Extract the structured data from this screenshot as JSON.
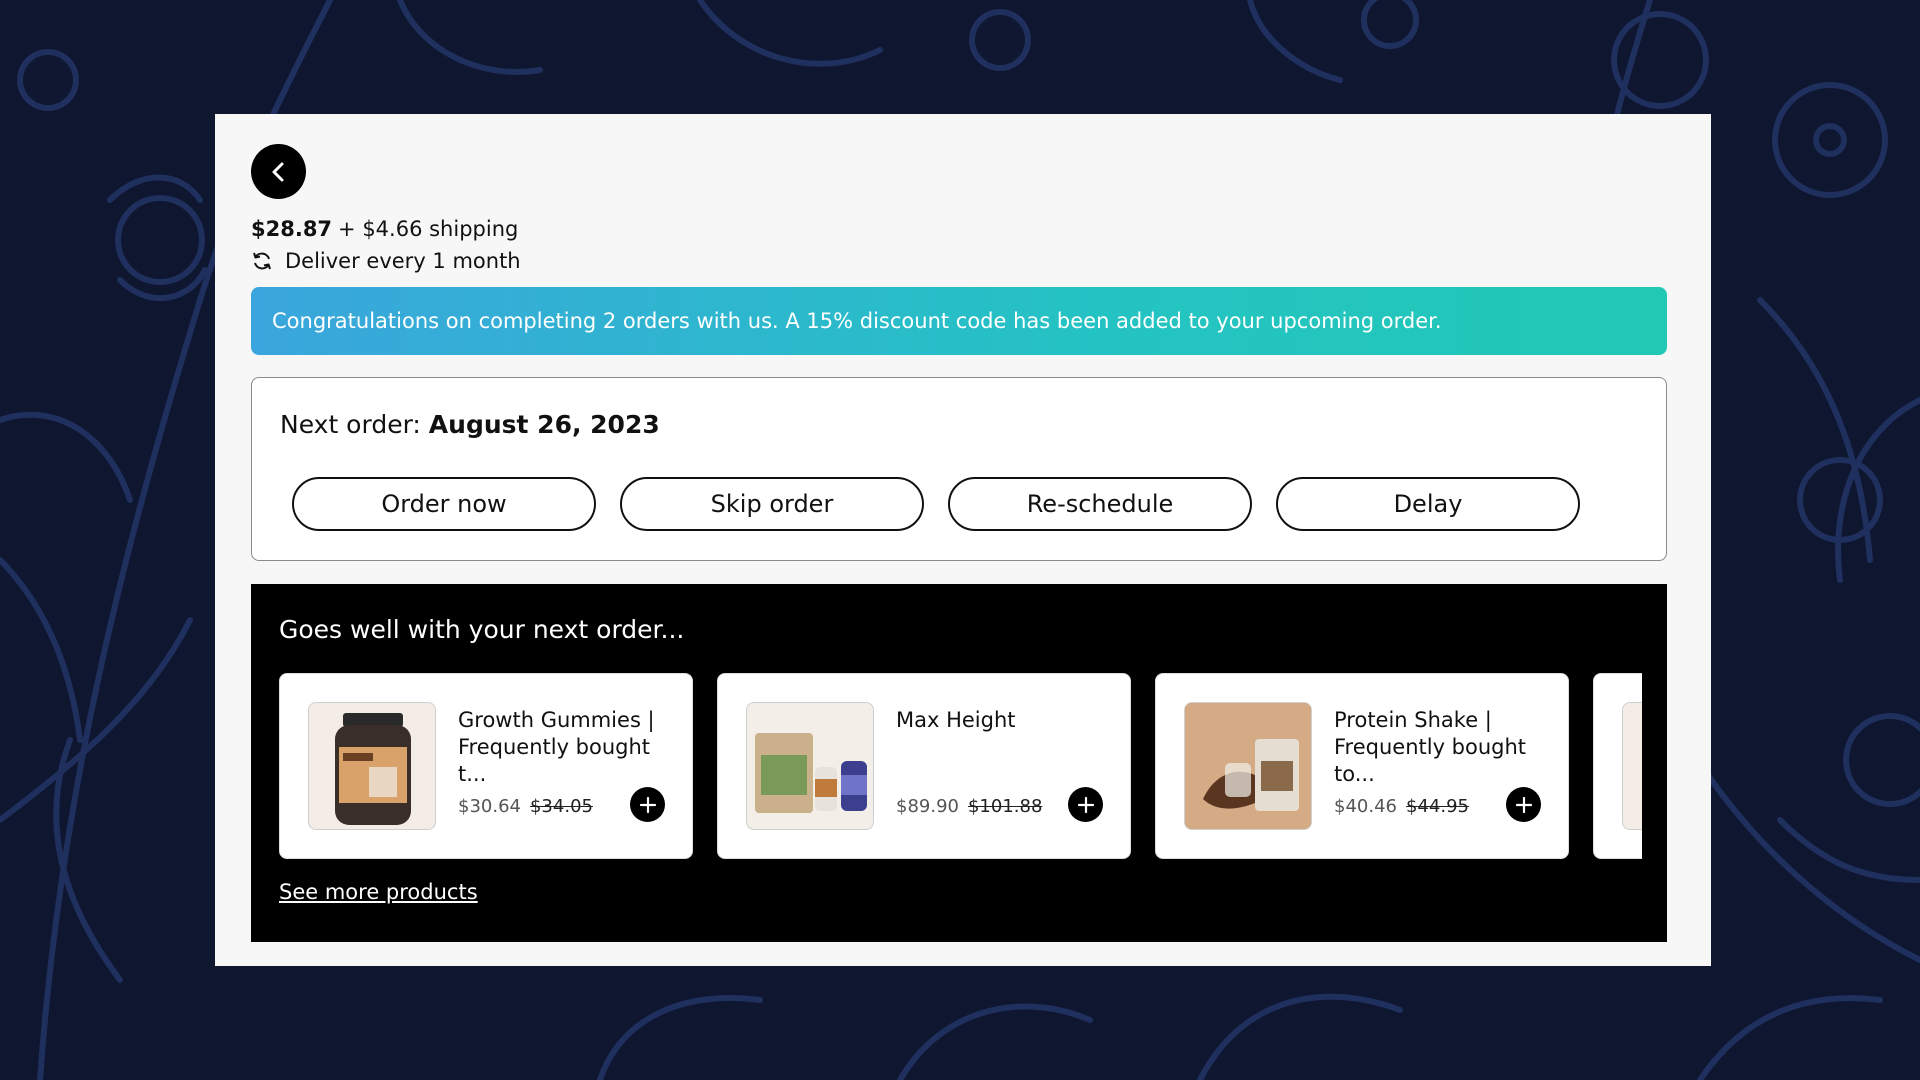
{
  "colors": {
    "background": "#0f1630",
    "pattern": "#1f2f5e",
    "panel": "#f7f7f7",
    "banner_start": "#3aa6dd",
    "banner_end": "#22c8b4",
    "upsell_bg": "#000000"
  },
  "header": {
    "back_icon": "chevron-left-icon",
    "price": "$28.87",
    "shipping": "+ $4.66 shipping",
    "frequency_icon": "refresh-icon",
    "frequency": "Deliver every 1 month"
  },
  "banner": {
    "message": "Congratulations on completing 2 orders with us. A 15% discount code has been added to your upcoming order."
  },
  "next_order": {
    "label": "Next order:",
    "date": "August 26, 2023",
    "actions": {
      "order_now": "Order now",
      "skip": "Skip order",
      "reschedule": "Re-schedule",
      "delay": "Delay"
    }
  },
  "upsell": {
    "title": "Goes well with your next order...",
    "products": [
      {
        "name": "Growth Gummies | Frequently bought t...",
        "price": "$30.64",
        "compare_price": "$34.05",
        "add_icon": "plus-icon"
      },
      {
        "name": "Max Height",
        "price": "$89.90",
        "compare_price": "$101.88",
        "add_icon": "plus-icon"
      },
      {
        "name": "Protein Shake | Frequently bought to...",
        "price": "$40.46",
        "compare_price": "$44.95",
        "add_icon": "plus-icon"
      }
    ],
    "see_more": "See more products"
  }
}
